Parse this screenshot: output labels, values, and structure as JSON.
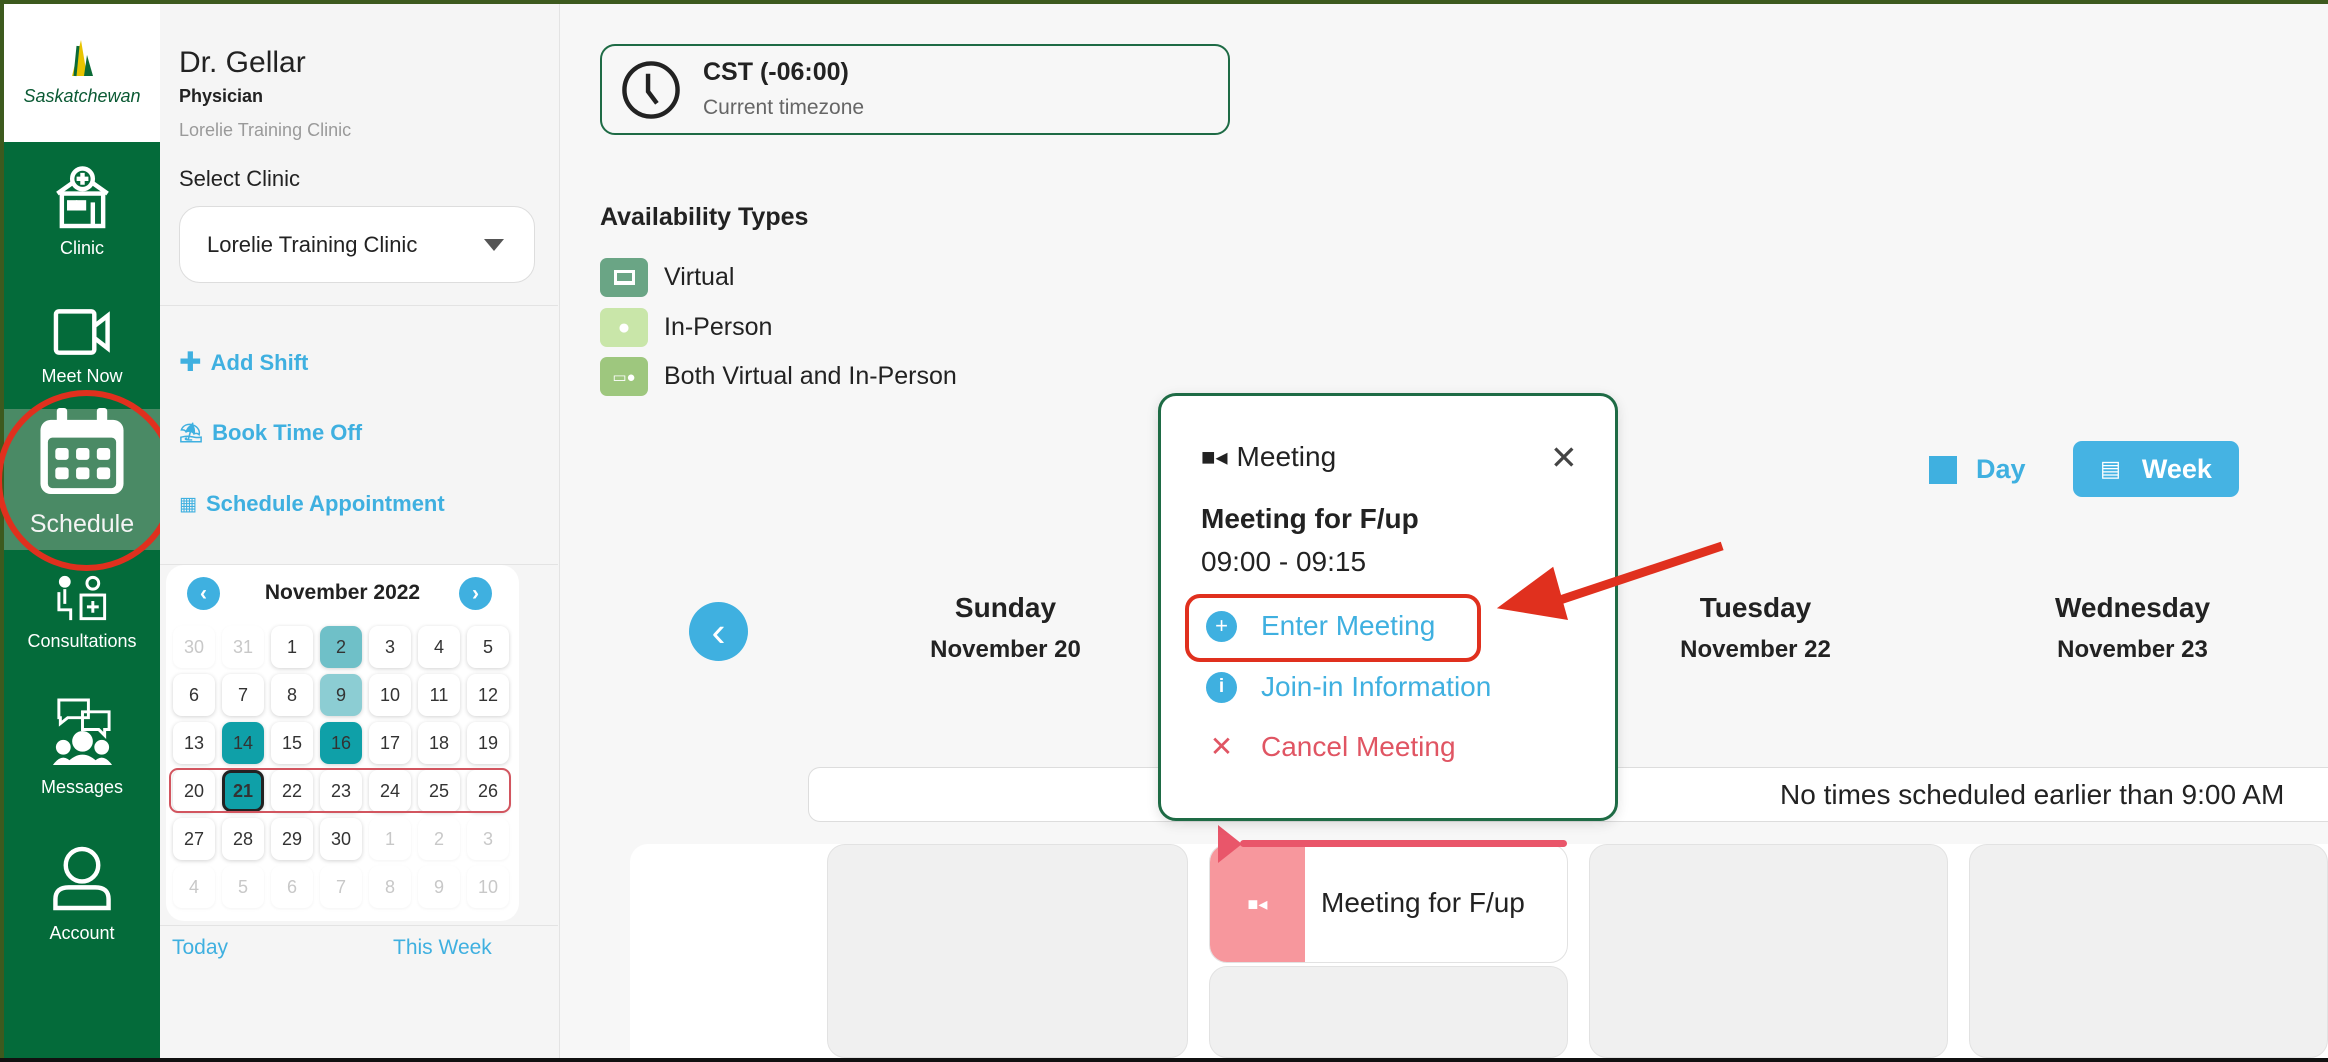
{
  "brand": {
    "logo_text": "Saskatchewan"
  },
  "nav": {
    "items": [
      {
        "label": "Clinic",
        "icon": "clinic-icon"
      },
      {
        "label": "Meet Now",
        "icon": "video-camera-icon"
      },
      {
        "label": "Schedule",
        "icon": "calendar-icon",
        "active": true
      },
      {
        "label": "Consultations",
        "icon": "consultation-icon"
      },
      {
        "label": "Messages",
        "icon": "messages-icon"
      },
      {
        "label": "Account",
        "icon": "user-icon"
      }
    ]
  },
  "profile": {
    "name": "Dr. Gellar",
    "role": "Physician",
    "clinic": "Lorelie Training Clinic"
  },
  "clinic_select": {
    "label": "Select Clinic",
    "value": "Lorelie Training Clinic"
  },
  "actions": {
    "add_shift": "Add Shift",
    "book_time_off": "Book Time Off",
    "schedule_appointment": "Schedule Appointment"
  },
  "mini_calendar": {
    "month": "November 2022",
    "weeks": [
      [
        "30",
        "31",
        "1",
        "2",
        "3",
        "4",
        "5"
      ],
      [
        "6",
        "7",
        "8",
        "9",
        "10",
        "11",
        "12"
      ],
      [
        "13",
        "14",
        "15",
        "16",
        "17",
        "18",
        "19"
      ],
      [
        "20",
        "21",
        "22",
        "23",
        "24",
        "25",
        "26"
      ],
      [
        "27",
        "28",
        "29",
        "30",
        "1",
        "2",
        "3"
      ],
      [
        "4",
        "5",
        "6",
        "7",
        "8",
        "9",
        "10"
      ]
    ],
    "selected": "21",
    "today_link": "Today",
    "this_week_link": "This Week"
  },
  "timezone": {
    "name": "CST (-06:00)",
    "caption": "Current timezone"
  },
  "availability": {
    "title": "Availability Types",
    "types": [
      {
        "label": "Virtual",
        "color": "#6aa585"
      },
      {
        "label": "In-Person",
        "color": "#c9e6a9"
      },
      {
        "label": "Both Virtual and In-Person",
        "color": "#9ec77e"
      }
    ]
  },
  "view_toggle": {
    "day": "Day",
    "week": "Week",
    "selected": "Week"
  },
  "week_days": [
    {
      "name": "Sunday",
      "date": "November 20"
    },
    {
      "name": "Tuesday",
      "date": "November 22"
    },
    {
      "name": "Wednesday",
      "date": "November 23"
    }
  ],
  "banner": "No times scheduled earlier than 9:00 AM",
  "event": {
    "title": "Meeting for F/up"
  },
  "popup": {
    "type": "Meeting",
    "title": "Meeting for F/up",
    "time": "09:00 - 09:15",
    "enter": "Enter Meeting",
    "join_info": "Join-in Information",
    "cancel": "Cancel Meeting"
  },
  "colors": {
    "nav_green": "#046b3a",
    "accent_blue": "#3fb0e0",
    "cancel_red": "#e05563",
    "annotation_red": "#e0301e"
  }
}
